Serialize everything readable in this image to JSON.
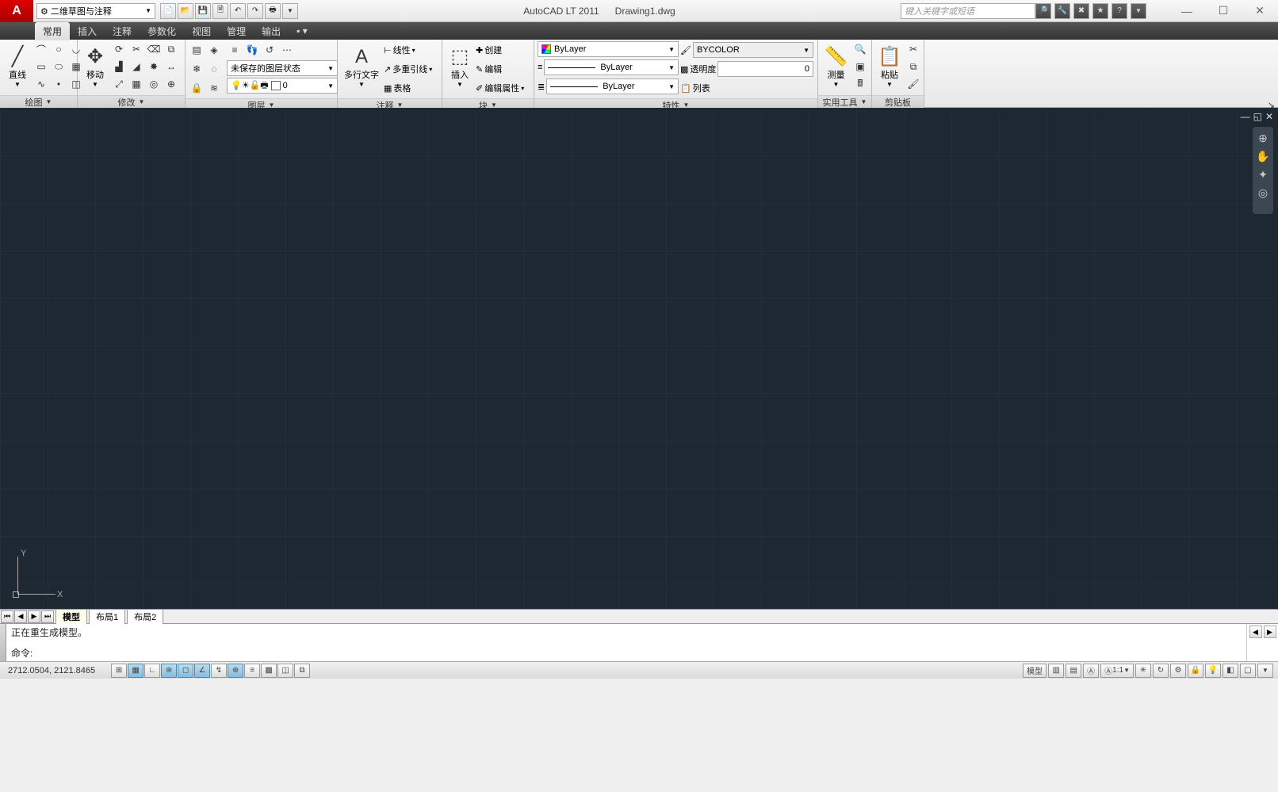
{
  "title": {
    "app": "AutoCAD LT 2011",
    "doc": "Drawing1.dwg"
  },
  "workspace": "二维草图与注释",
  "search_placeholder": "键入关键字或短语",
  "menu": {
    "active": "常用",
    "items": [
      "常用",
      "插入",
      "注释",
      "参数化",
      "视图",
      "管理",
      "输出"
    ]
  },
  "panels": {
    "draw": {
      "title": "绘图",
      "main_label": "直线"
    },
    "modify": {
      "title": "修改",
      "main_label": "移动"
    },
    "layer": {
      "title": "图层",
      "state_label": "未保存的图层状态",
      "current": "0"
    },
    "annot": {
      "title": "注释",
      "main_label": "多行文字",
      "items": [
        "线性",
        "多重引线",
        "表格"
      ]
    },
    "block": {
      "title": "块",
      "main_label": "插入",
      "items": [
        "创建",
        "编辑",
        "编辑属性"
      ]
    },
    "props": {
      "title": "特性",
      "layer_color": "ByLayer",
      "linetype": "ByLayer",
      "lineweight": "ByLayer",
      "bycolor": "BYCOLOR",
      "transparency_label": "透明度",
      "transparency_value": "0",
      "list_label": "列表"
    },
    "util": {
      "title": "实用工具",
      "main_label": "测量"
    },
    "clip": {
      "title": "剪贴板",
      "main_label": "粘贴"
    }
  },
  "layout_tabs": {
    "active": "模型",
    "items": [
      "模型",
      "布局1",
      "布局2"
    ]
  },
  "command": {
    "history": "正在重生成模型。",
    "prompt": "命令:"
  },
  "status": {
    "coords": "2712.0504, 2121.8465",
    "model_label": "模型",
    "scale_label": "1:1"
  },
  "ucs": {
    "x": "X",
    "y": "Y"
  },
  "win": {
    "min": "—",
    "max": "☐",
    "close": "✕"
  }
}
